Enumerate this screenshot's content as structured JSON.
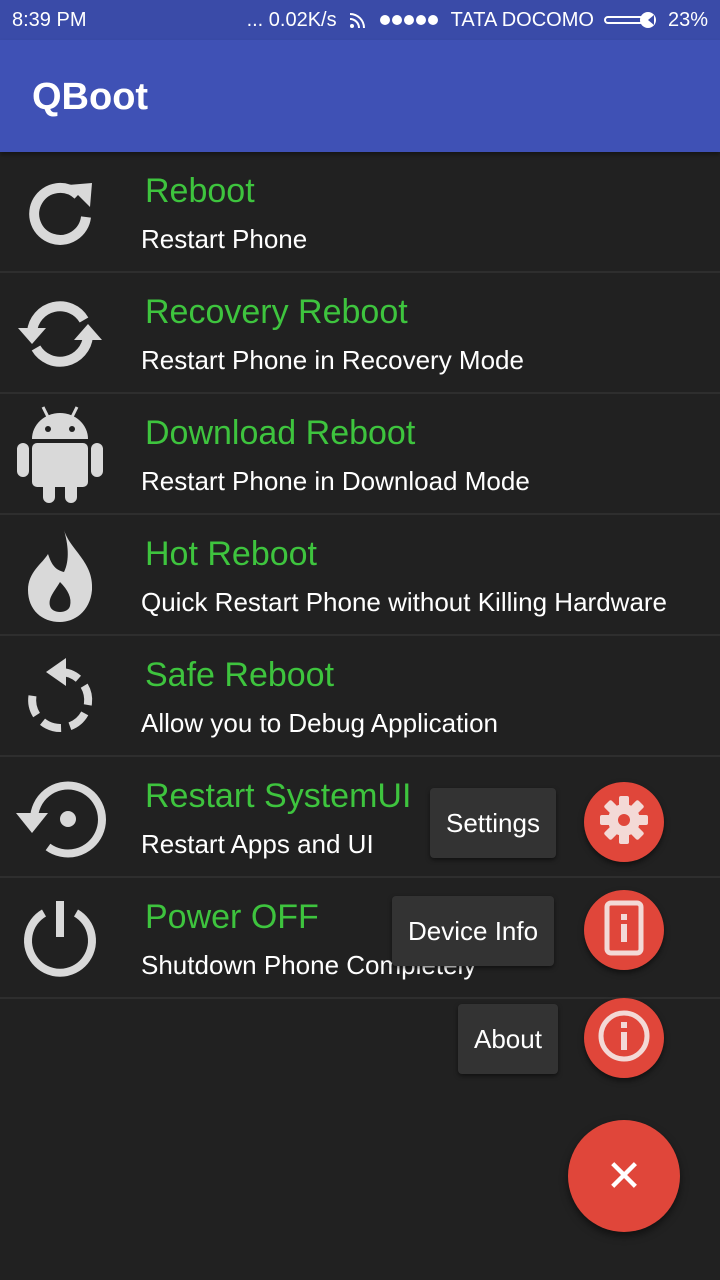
{
  "status_bar": {
    "time": "8:39 PM",
    "network_speed": "... 0.02K/s",
    "carrier": "TATA DOCOMO",
    "battery": "23%",
    "icons": [
      "wifi-icon",
      "signal-dots-icon",
      "battery-icon"
    ]
  },
  "app_bar": {
    "title": "QBoot"
  },
  "items": [
    {
      "title": "Reboot",
      "subtitle": "Restart Phone",
      "icon": "reboot-icon"
    },
    {
      "title": "Recovery Reboot",
      "subtitle": "Restart Phone in Recovery Mode",
      "icon": "sync-icon"
    },
    {
      "title": "Download Reboot",
      "subtitle": "Restart Phone in Download Mode",
      "icon": "android-icon"
    },
    {
      "title": "Hot Reboot",
      "subtitle": "Quick Restart Phone without Killing Hardware",
      "icon": "flame-icon"
    },
    {
      "title": "Safe Reboot",
      "subtitle": "Allow you to Debug Application",
      "icon": "safe-restart-icon"
    },
    {
      "title": "Restart SystemUI",
      "subtitle": "Restart Apps and UI",
      "icon": "restore-icon"
    },
    {
      "title": "Power OFF",
      "subtitle": "Shutdown Phone Completely",
      "icon": "power-icon"
    }
  ],
  "fab_menu": {
    "settings_label": "Settings",
    "device_info_label": "Device Info",
    "about_label": "About",
    "close_symbol": "✕"
  },
  "colors": {
    "app_bar": "#3f51b5",
    "status_bar": "#3a4ba8",
    "background": "#212121",
    "title_text": "#3ec43e",
    "fab": "#e0463a"
  }
}
